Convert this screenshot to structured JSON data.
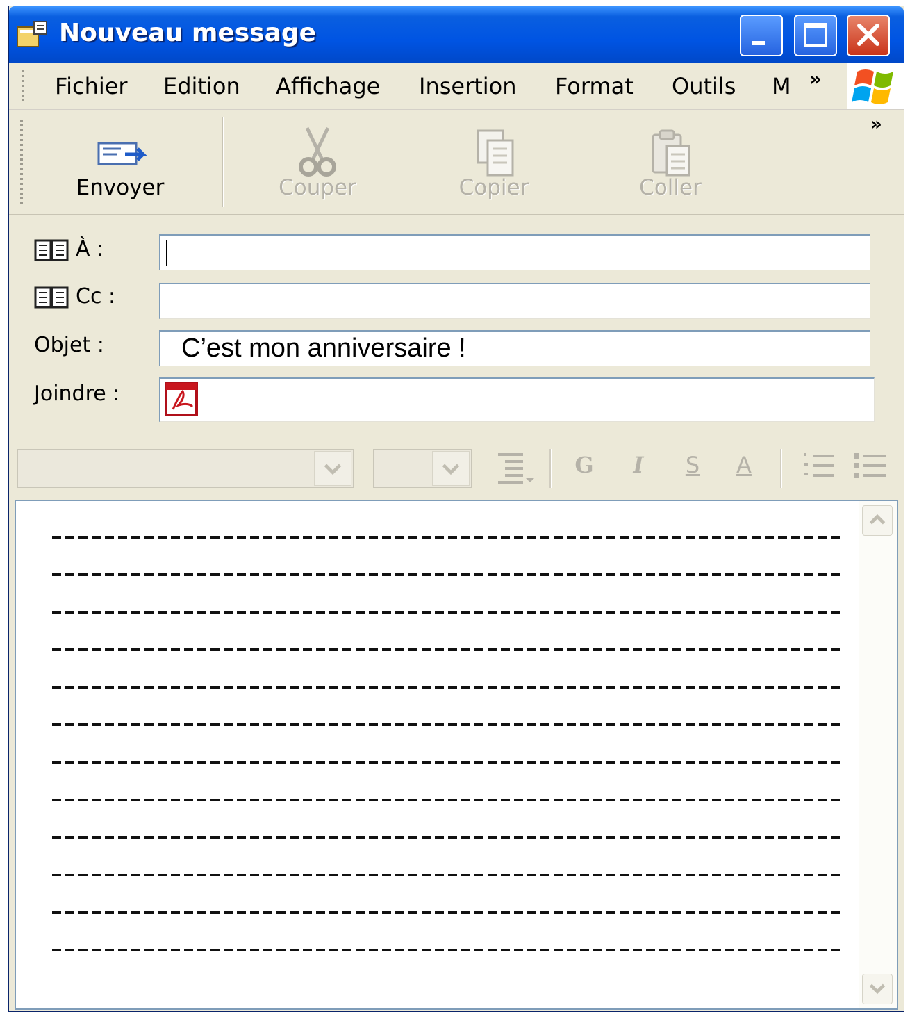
{
  "window": {
    "title": "Nouveau message"
  },
  "menu": {
    "items": [
      "Fichier",
      "Edition",
      "Affichage",
      "Insertion",
      "Format",
      "Outils",
      "M"
    ],
    "more": "»"
  },
  "toolbar": {
    "send_label": "Envoyer",
    "cut_label": "Couper",
    "copy_label": "Copier",
    "paste_label": "Coller",
    "more": "»"
  },
  "fields": {
    "to_label": "À :",
    "to_value": "",
    "cc_label": "Cc :",
    "cc_value": "",
    "subject_label": "Objet :",
    "subject_value": "C’est mon anniversaire !",
    "attach_label": "Joindre :"
  },
  "format_bar": {
    "bold": "G",
    "italic": "I",
    "underline": "S",
    "font_color": "A"
  },
  "body": {
    "line_count": 12
  },
  "colors": {
    "titlebar": "#0054e3",
    "close_button": "#c9341a",
    "window_face": "#ece9d8",
    "field_border": "#7f9db9"
  }
}
